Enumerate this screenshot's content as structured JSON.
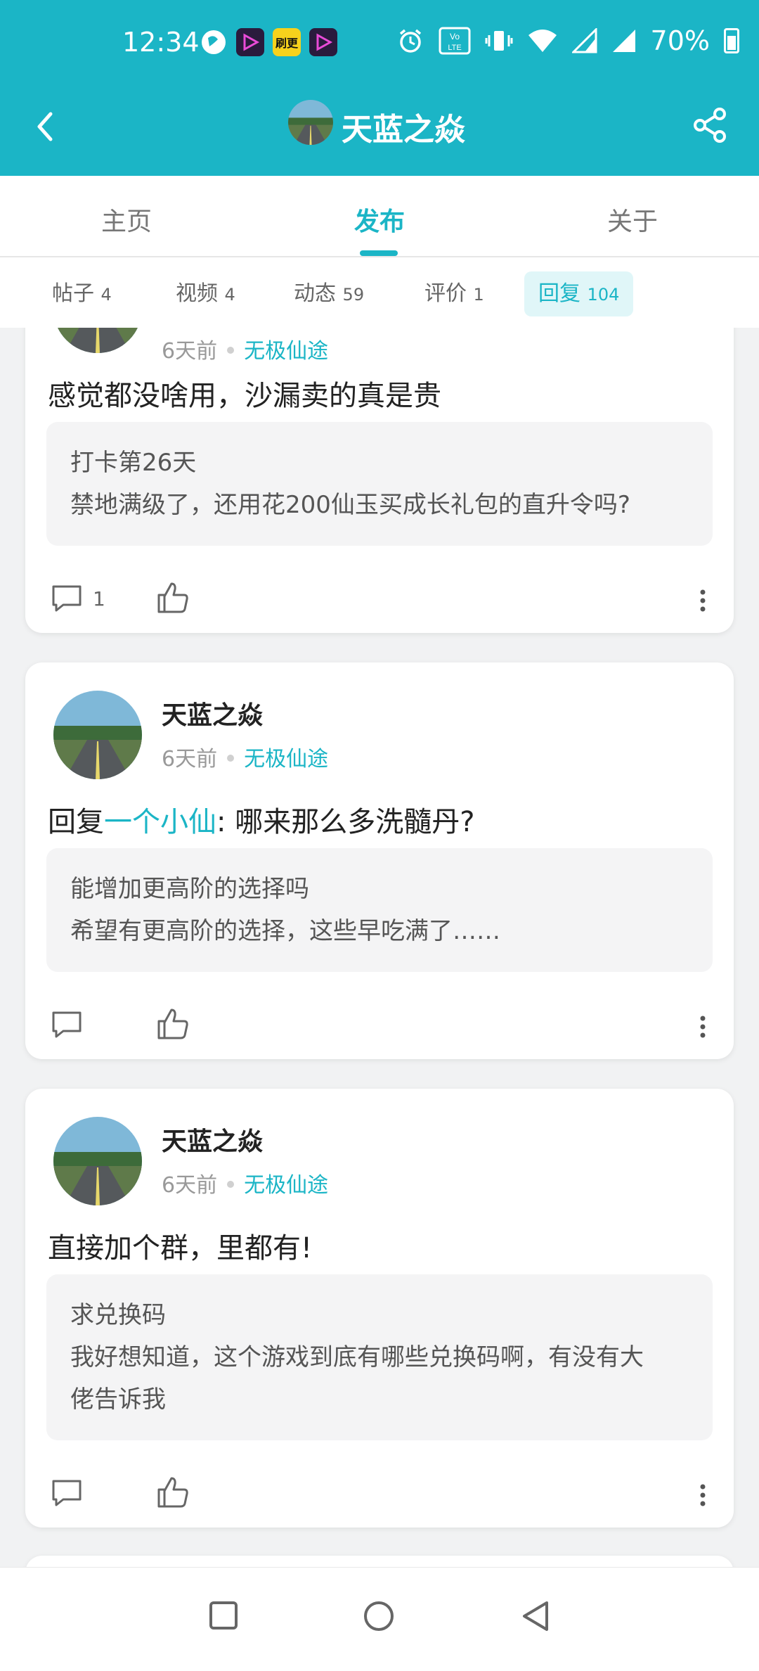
{
  "status_bar": {
    "time": "12:34",
    "battery": "70%",
    "app_badge_2": "刷更"
  },
  "header": {
    "title": "天蓝之焱"
  },
  "tabs": [
    {
      "label": "主页"
    },
    {
      "label": "发布"
    },
    {
      "label": "关于"
    }
  ],
  "active_tab": "发布",
  "chips": [
    {
      "label": "帖子",
      "count": "4"
    },
    {
      "label": "视频",
      "count": "4"
    },
    {
      "label": "动态",
      "count": "59"
    },
    {
      "label": "评价",
      "count": "1"
    },
    {
      "label": "回复",
      "count": "104"
    }
  ],
  "posts": [
    {
      "author": "天蓝之焱",
      "time": "6天前",
      "game": "无极仙途",
      "content": "感觉都没啥用，沙漏卖的真是贵",
      "quote_title": "打卡第26天",
      "quote_body": "禁地满级了，还用花200仙玉买成长礼包的直升令吗?",
      "comment_count": "1"
    },
    {
      "author": "天蓝之焱",
      "time": "6天前",
      "game": "无极仙途",
      "reply_prefix": "回复",
      "reply_to": "一个小仙",
      "reply_sep": ":",
      "content": "哪来那么多洗髓丹?",
      "quote_title": "能增加更高阶的选择吗",
      "quote_body": "希望有更高阶的选择，这些早吃满了……"
    },
    {
      "author": "天蓝之焱",
      "time": "6天前",
      "game": "无极仙途",
      "content": "直接加个群，里都有!",
      "quote_title": "求兑换码",
      "quote_body_1": "我好想知道，这个游戏到底有哪些兑换码啊，有没有大",
      "quote_body_2": "佬告诉我"
    }
  ],
  "colors": {
    "accent": "#1bb5c6",
    "header_bg": "#1bb5c6",
    "quote_bg": "#f4f4f5"
  }
}
